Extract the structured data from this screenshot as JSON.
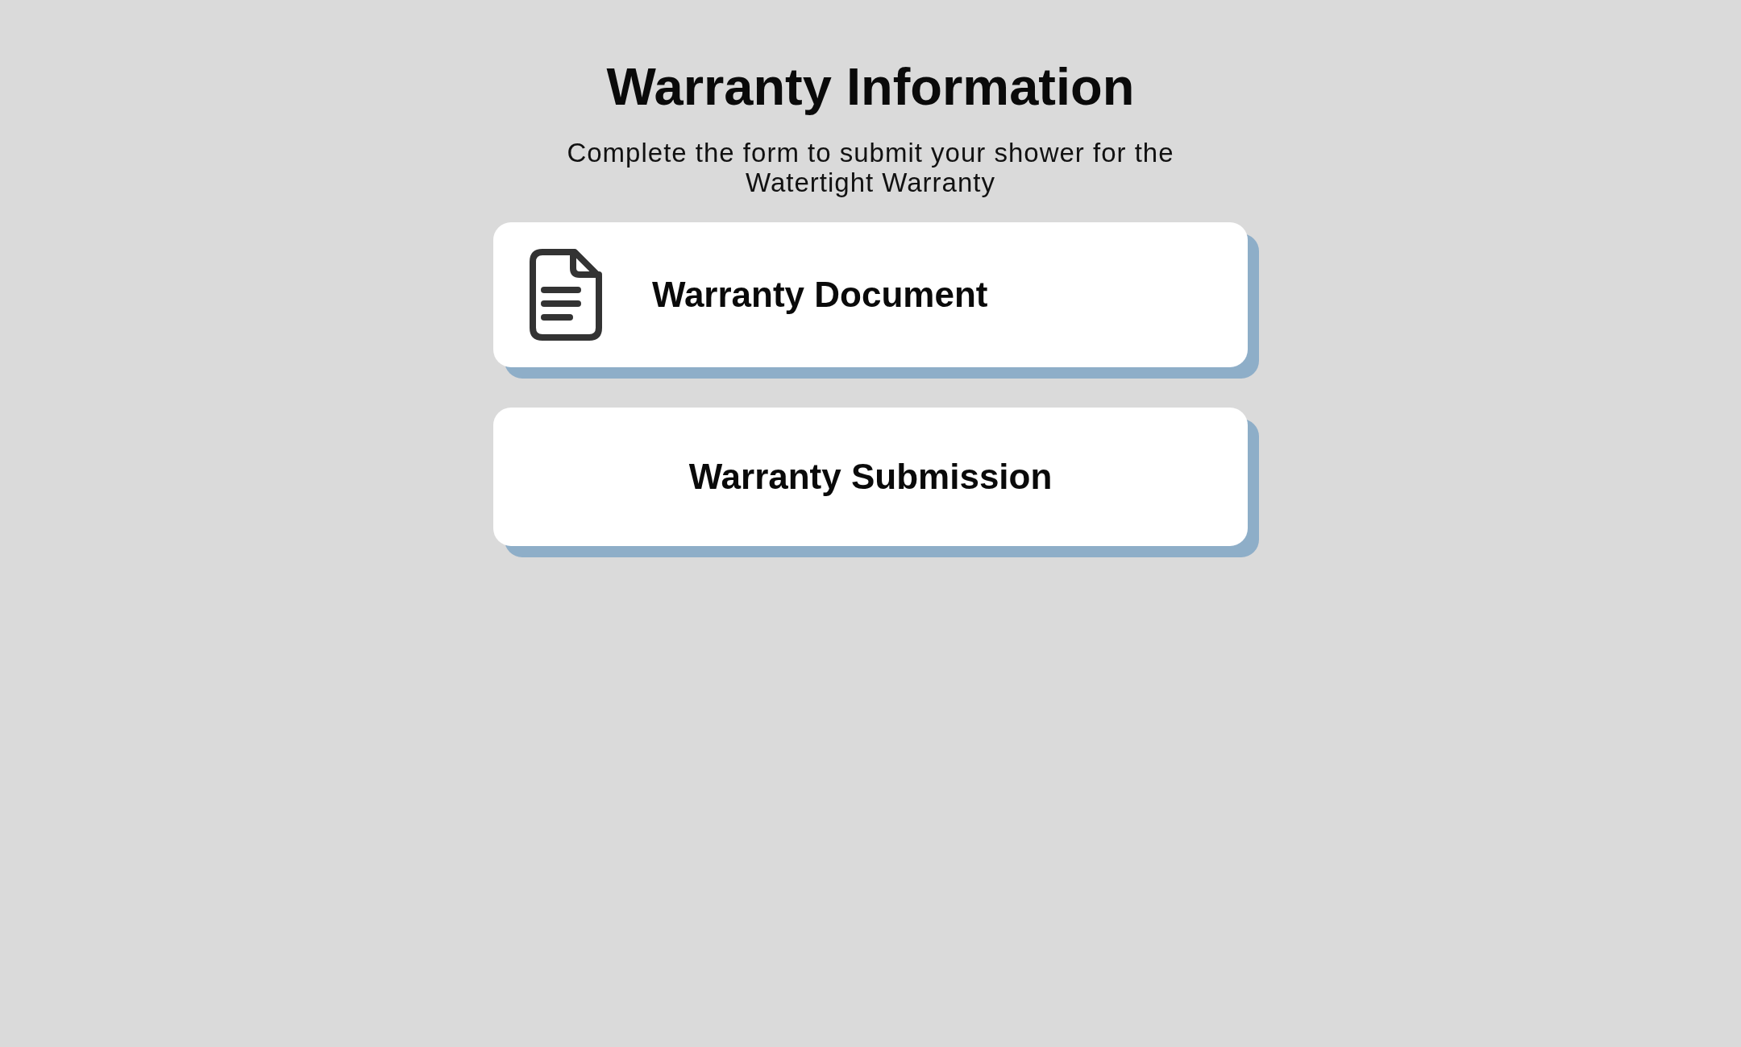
{
  "title": "Warranty Information",
  "subtitle": "Complete the form to submit your shower for the Watertight Warranty",
  "cards": [
    {
      "kind": "document",
      "label": "Warranty Document"
    },
    {
      "kind": "plain",
      "label": "Warranty Submission"
    }
  ]
}
